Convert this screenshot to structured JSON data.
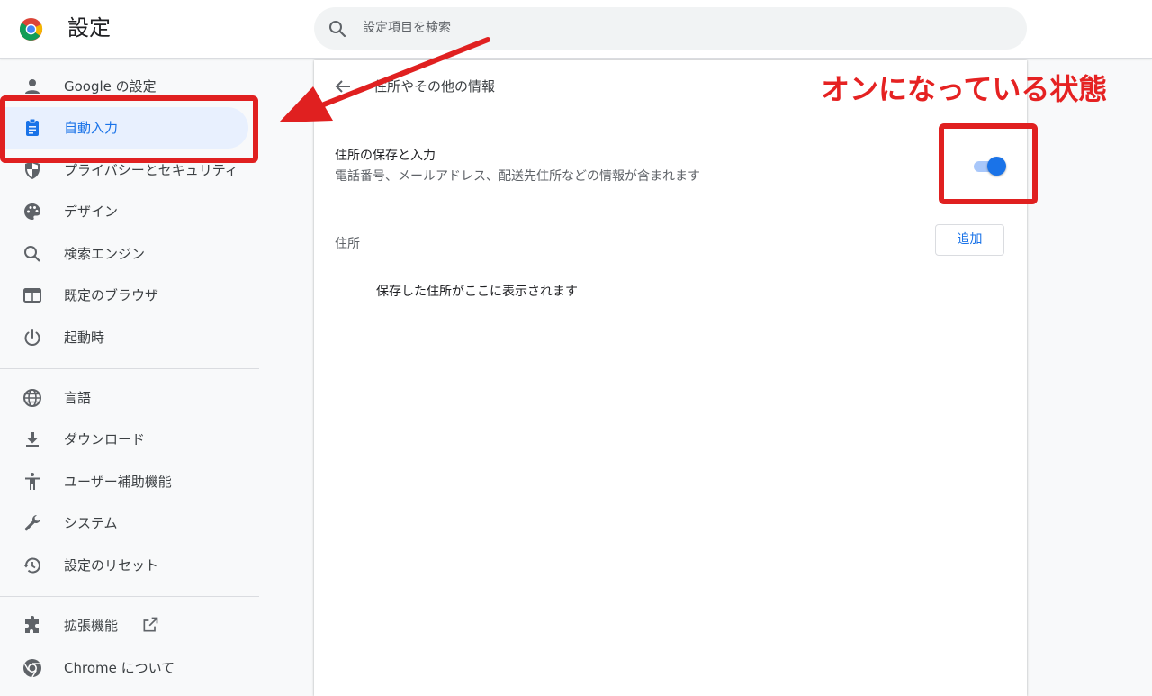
{
  "header": {
    "title": "設定",
    "search_placeholder": "設定項目を検索"
  },
  "sidebar": {
    "items": [
      {
        "label": "Google の設定",
        "icon": "person-icon",
        "active": false
      },
      {
        "label": "自動入力",
        "icon": "clipboard-icon",
        "active": true
      },
      {
        "label": "プライバシーとセキュリティ",
        "icon": "shield-icon",
        "active": false
      },
      {
        "label": "デザイン",
        "icon": "palette-icon",
        "active": false
      },
      {
        "label": "検索エンジン",
        "icon": "search-icon",
        "active": false
      },
      {
        "label": "既定のブラウザ",
        "icon": "browser-window-icon",
        "active": false
      },
      {
        "label": "起動時",
        "icon": "power-icon",
        "active": false
      },
      {
        "label": "言語",
        "icon": "globe-icon",
        "active": false
      },
      {
        "label": "ダウンロード",
        "icon": "download-icon",
        "active": false
      },
      {
        "label": "ユーザー補助機能",
        "icon": "accessibility-icon",
        "active": false
      },
      {
        "label": "システム",
        "icon": "wrench-icon",
        "active": false
      },
      {
        "label": "設定のリセット",
        "icon": "history-icon",
        "active": false
      },
      {
        "label": "拡張機能",
        "icon": "puzzle-icon",
        "active": false
      },
      {
        "label": "Chrome について",
        "icon": "chrome-icon",
        "active": false
      }
    ]
  },
  "main": {
    "page_title": "住所やその他の情報",
    "setting_title": "住所の保存と入力",
    "setting_subtitle": "電話番号、メールアドレス、配送先住所などの情報が含まれます",
    "toggle_on": true,
    "section_label": "住所",
    "add_button": "追加",
    "empty_message": "保存した住所がここに表示されます"
  },
  "annotation": {
    "text": "オンになっている状態",
    "color": "#e02020"
  },
  "colors": {
    "accent": "#1a73e8",
    "active_bg": "#e8f0fe"
  }
}
